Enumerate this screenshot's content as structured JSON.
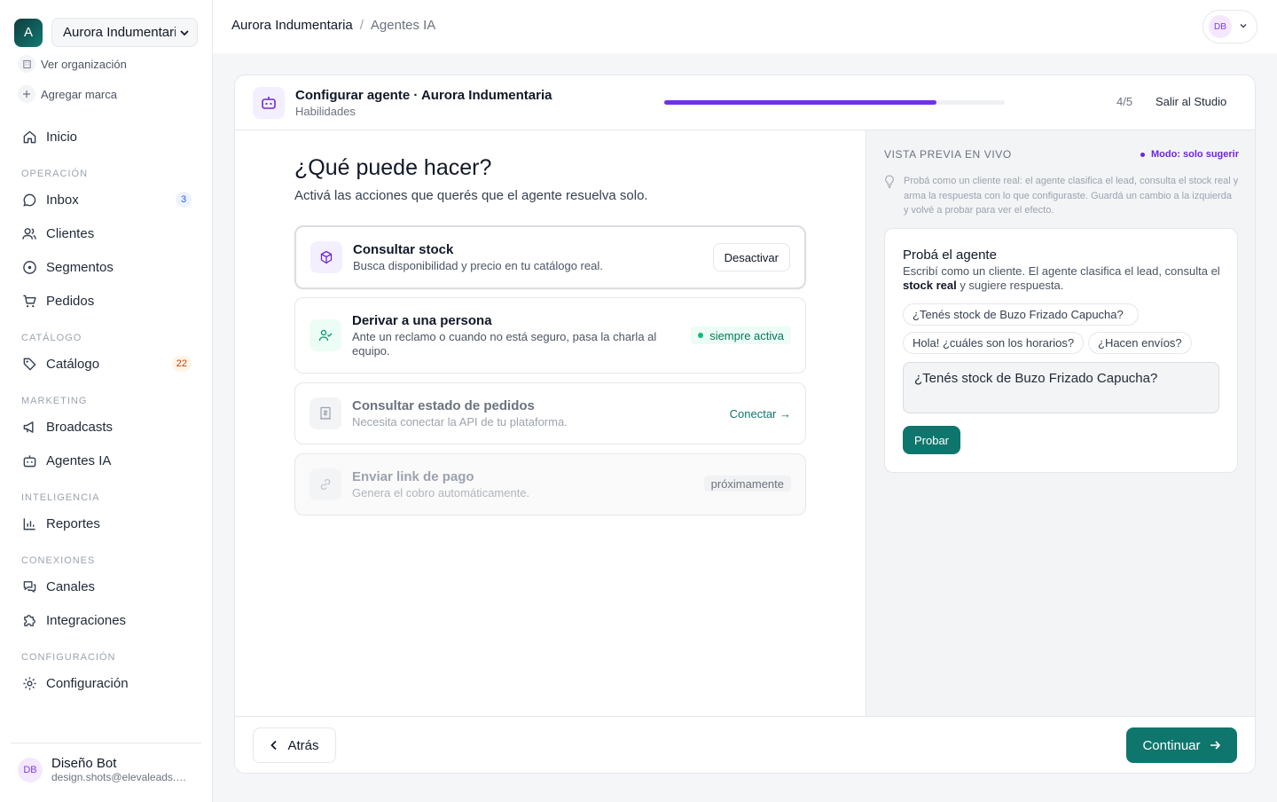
{
  "sidebar": {
    "org_initial": "A",
    "org_name": "Aurora Indumentaria",
    "view_org": "Ver organización",
    "add_brand": "Agregar marca",
    "home": "Inicio",
    "sections": {
      "operacion": "OPERACIÓN",
      "catalogo": "CATÁLOGO",
      "marketing": "MARKETING",
      "inteligencia": "INTELIGENCIA",
      "conexiones": "CONEXIONES",
      "configuracion": "CONFIGURACIÓN"
    },
    "items": {
      "inbox": "Inbox",
      "inbox_badge": "3",
      "clientes": "Clientes",
      "segmentos": "Segmentos",
      "pedidos": "Pedidos",
      "catalogo": "Catálogo",
      "catalogo_badge": "22",
      "broadcasts": "Broadcasts",
      "agentes": "Agentes IA",
      "reportes": "Reportes",
      "canales": "Canales",
      "integraciones": "Integraciones",
      "configuracion": "Configuración"
    },
    "user": {
      "initials": "DB",
      "name": "Diseño Bot",
      "email": "design.shots@elevaleads.com"
    }
  },
  "topbar": {
    "crumb1": "Aurora Indumentaria",
    "sep": "/",
    "crumb2": "Agentes IA",
    "avatar": "DB"
  },
  "wizard": {
    "title": "Configurar agente · Aurora Indumentaria",
    "subtitle": "Habilidades",
    "progress": 0.8,
    "step": "4/5",
    "exit": "Salir al Studio",
    "heading": "¿Qué puede hacer?",
    "subheading": "Activá las acciones que querés que el agente resuelva solo.",
    "skills": [
      {
        "name": "Consultar stock",
        "desc": "Busca disponibilidad y precio en tu catálogo real.",
        "action": "Desactivar"
      },
      {
        "name": "Derivar a una persona",
        "desc": "Ante un reclamo o cuando no está seguro, pasa la charla al equipo.",
        "status": "siempre activa"
      },
      {
        "name": "Consultar estado de pedidos",
        "desc": "Necesita conectar la API de tu plataforma.",
        "action": "Conectar →"
      },
      {
        "name": "Enviar link de pago",
        "desc": "Genera el cobro automáticamente.",
        "status": "próximamente"
      }
    ],
    "back": "Atrás",
    "next": "Continuar"
  },
  "preview": {
    "label": "VISTA PREVIA EN VIVO",
    "mode": "Modo: solo sugerir",
    "tip": "Probá como un cliente real: el agente clasifica el lead, consulta el stock real y arma la respuesta con lo que configuraste. Guardá un cambio a la izquierda y volvé a probar para ver el efecto.",
    "card_title": "Probá el agente",
    "card_desc_1": "Escribí como un cliente. El agente clasifica el lead, consulta el ",
    "card_desc_bold": "stock real",
    "card_desc_2": " y sugiere respuesta.",
    "chips": [
      "¿Tenés stock de Buzo Frizado Capucha?",
      "Hola! ¿cuáles son los horarios?",
      "¿Hacen envíos?"
    ],
    "input_value": "¿Tenés stock de Buzo Frizado Capucha?",
    "try_button": "Probar"
  },
  "colors": {
    "accent": "#0f766e",
    "progress": "#6d33e6",
    "mode": "#6d28d9"
  },
  "icons": [
    "chevron-down-icon",
    "building-icon",
    "plus-icon",
    "home-icon",
    "chat-icon",
    "users-icon",
    "segment-icon",
    "cart-icon",
    "tag-icon",
    "megaphone-icon",
    "robot-icon",
    "bar-chart-icon",
    "channels-icon",
    "puzzle-icon",
    "gear-icon",
    "cube-icon",
    "handoff-icon",
    "receipt-icon",
    "link-icon",
    "lightbulb-icon",
    "chevron-left-icon",
    "arrow-right-icon"
  ]
}
